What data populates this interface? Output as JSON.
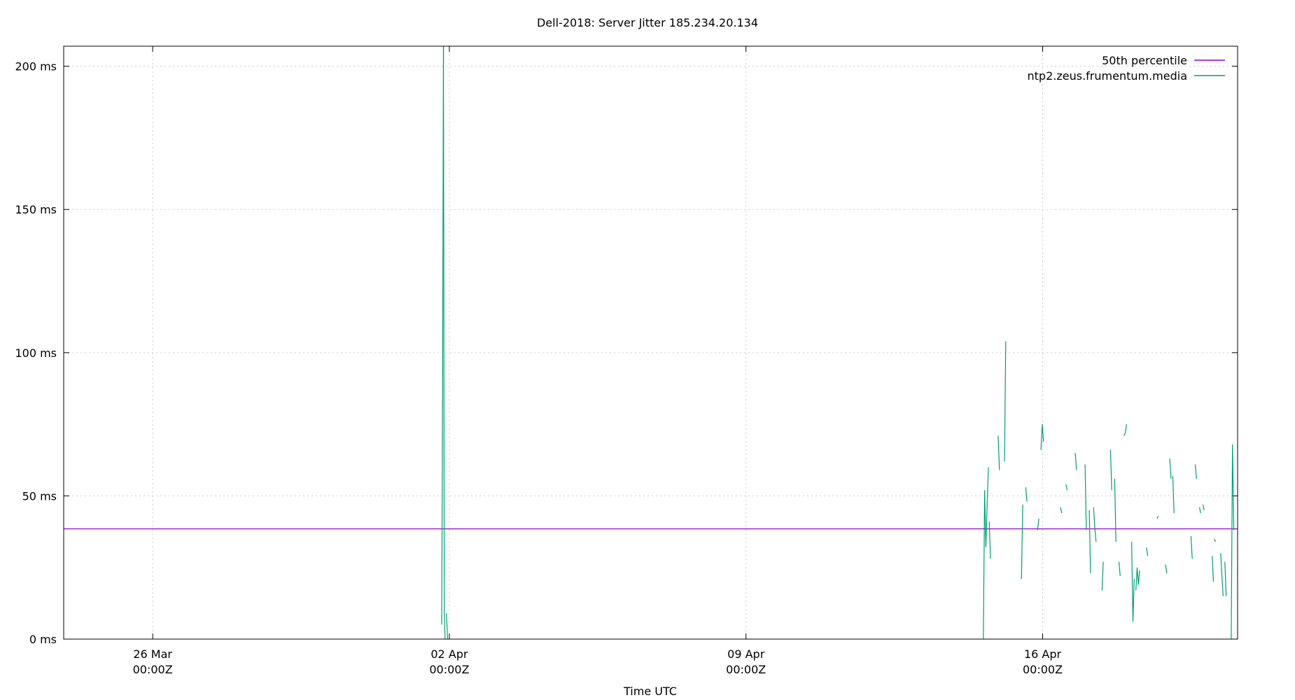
{
  "chart_data": {
    "type": "line",
    "title": "Dell-2018: Server Jitter 185.234.20.134",
    "xlabel": "Time UTC",
    "ylabel": "",
    "x_unit": "days since 2018-03-26 00:00Z",
    "xlim": [
      -2.1,
      25.6
    ],
    "ylim": [
      0,
      207
    ],
    "y_ticks": [
      {
        "value": 0,
        "label": "0 ms"
      },
      {
        "value": 50,
        "label": "50 ms"
      },
      {
        "value": 100,
        "label": "100 ms"
      },
      {
        "value": 150,
        "label": "150 ms"
      },
      {
        "value": 200,
        "label": "200 ms"
      }
    ],
    "x_ticks": [
      {
        "value": 0,
        "line1": "26 Mar",
        "line2": "00:00Z"
      },
      {
        "value": 7,
        "line1": "02 Apr",
        "line2": "00:00Z"
      },
      {
        "value": 14,
        "line1": "09 Apr",
        "line2": "00:00Z"
      },
      {
        "value": 21,
        "line1": "16 Apr",
        "line2": "00:00Z"
      }
    ],
    "grid": true,
    "legend_position": "top-right",
    "series": [
      {
        "name": "50th percentile",
        "color": "#9400d3",
        "segments": [
          [
            [
              -2.1,
              38.5
            ],
            [
              25.6,
              38.5
            ]
          ]
        ]
      },
      {
        "name": "ntp2.zeus.frumentum.media",
        "color": "#009e73",
        "segments": [
          [
            [
              6.82,
              5
            ],
            [
              6.84,
              80
            ],
            [
              6.86,
              207
            ]
          ],
          [
            [
              6.86,
              207
            ],
            [
              6.88,
              9
            ],
            [
              6.9,
              0
            ]
          ],
          [
            [
              6.93,
              9
            ],
            [
              6.96,
              0
            ]
          ],
          [
            [
              19.6,
              0
            ],
            [
              19.63,
              52
            ],
            [
              19.66,
              32
            ],
            [
              19.69,
              47
            ],
            [
              19.72,
              60
            ]
          ],
          [
            [
              19.74,
              41
            ],
            [
              19.77,
              28
            ]
          ],
          [
            [
              19.95,
              71
            ],
            [
              19.98,
              59
            ]
          ],
          [
            [
              20.1,
              62
            ],
            [
              20.13,
              104
            ]
          ],
          [
            [
              20.5,
              21
            ],
            [
              20.53,
              47
            ]
          ],
          [
            [
              20.6,
              53
            ],
            [
              20.63,
              48
            ]
          ],
          [
            [
              20.88,
              38
            ],
            [
              20.91,
              42
            ]
          ],
          [
            [
              20.96,
              66
            ],
            [
              20.99,
              75
            ],
            [
              21.02,
              69
            ]
          ],
          [
            [
              21.42,
              46
            ],
            [
              21.45,
              44
            ]
          ],
          [
            [
              21.55,
              54
            ],
            [
              21.58,
              52
            ]
          ],
          [
            [
              21.77,
              65
            ],
            [
              21.8,
              59
            ]
          ],
          [
            [
              22.0,
              61
            ],
            [
              22.03,
              38
            ]
          ],
          [
            [
              22.1,
              45
            ],
            [
              22.13,
              23
            ]
          ],
          [
            [
              22.2,
              46
            ],
            [
              22.23,
              39
            ],
            [
              22.26,
              34
            ]
          ],
          [
            [
              22.4,
              17
            ],
            [
              22.43,
              27
            ]
          ],
          [
            [
              22.6,
              66
            ],
            [
              22.63,
              52
            ]
          ],
          [
            [
              22.7,
              56
            ],
            [
              22.73,
              34
            ]
          ],
          [
            [
              22.8,
              27
            ],
            [
              22.83,
              22
            ]
          ],
          [
            [
              22.92,
              71
            ],
            [
              22.95,
              72
            ],
            [
              22.98,
              75
            ]
          ],
          [
            [
              23.1,
              34
            ],
            [
              23.13,
              6
            ],
            [
              23.16,
              21
            ]
          ],
          [
            [
              23.2,
              17
            ],
            [
              23.23,
              25
            ],
            [
              23.26,
              19
            ],
            [
              23.29,
              24
            ]
          ],
          [
            [
              23.45,
              32
            ],
            [
              23.48,
              29
            ]
          ],
          [
            [
              23.7,
              42
            ],
            [
              23.73,
              43
            ]
          ],
          [
            [
              23.9,
              26
            ],
            [
              23.93,
              23
            ]
          ],
          [
            [
              24.0,
              63
            ],
            [
              24.03,
              56
            ]
          ],
          [
            [
              24.07,
              57
            ],
            [
              24.1,
              44
            ]
          ],
          [
            [
              24.5,
              36
            ],
            [
              24.53,
              28
            ]
          ],
          [
            [
              24.6,
              61
            ],
            [
              24.63,
              56
            ]
          ],
          [
            [
              24.7,
              46
            ],
            [
              24.73,
              44
            ]
          ],
          [
            [
              24.78,
              47
            ],
            [
              24.81,
              45
            ]
          ],
          [
            [
              25.0,
              29
            ],
            [
              25.03,
              20
            ]
          ],
          [
            [
              25.05,
              35
            ],
            [
              25.08,
              34
            ]
          ],
          [
            [
              25.2,
              30
            ],
            [
              25.23,
              22
            ],
            [
              25.26,
              15
            ]
          ],
          [
            [
              25.3,
              27
            ],
            [
              25.33,
              15
            ]
          ],
          [
            [
              25.45,
              0
            ],
            [
              25.48,
              68
            ],
            [
              25.51,
              38
            ]
          ]
        ]
      }
    ]
  }
}
